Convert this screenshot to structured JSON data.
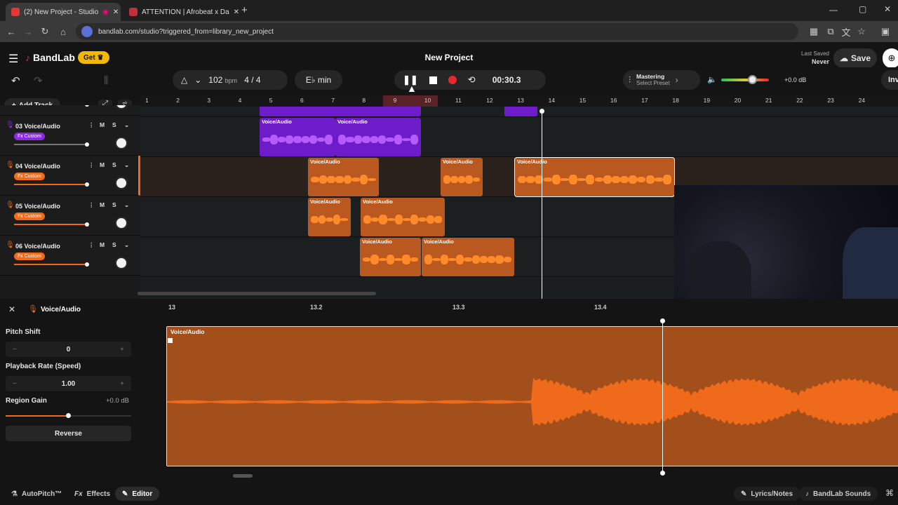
{
  "browser": {
    "tabs": [
      {
        "title": "(2) New Project - Studio",
        "active": true
      },
      {
        "title": "ATTENTION | Afrobeat x Da",
        "active": false
      }
    ],
    "url": "bandlab.com/studio?triggered_from=library_new_project"
  },
  "app": {
    "brand": "BandLab",
    "get_label": "Get",
    "project_title": "New Project",
    "last_saved_label": "Last Saved",
    "last_saved_value": "Never",
    "save_label": "Save"
  },
  "toolbar": {
    "bpm_value": "102",
    "bpm_unit": "bpm",
    "time_signature": "4 / 4",
    "key": "E♭ min",
    "time_display": "00:30.3",
    "mastering_title": "Mastering",
    "mastering_preset": "Select Preset",
    "master_volume": "+0.0 dB",
    "invite_label": "Inv"
  },
  "track_panel": {
    "add_track_label": "Add Track"
  },
  "ruler": {
    "bars": [
      "1",
      "2",
      "3",
      "4",
      "5",
      "6",
      "7",
      "8",
      "9",
      "10",
      "11",
      "12",
      "13",
      "14",
      "15",
      "16",
      "17",
      "18",
      "19",
      "20",
      "21",
      "22",
      "23",
      "24"
    ]
  },
  "tracks": [
    {
      "name": "",
      "fx": "Fx Custom",
      "color": "#8a2be2"
    },
    {
      "name": "03 Voice/Audio",
      "fx": "Fx Custom",
      "color": "#8a2be2"
    },
    {
      "name": "04 Voice/Audio",
      "fx": "Fx Custom",
      "color": "#ef6a1a"
    },
    {
      "name": "05 Voice/Audio",
      "fx": "Fx Custom",
      "color": "#ef6a1a"
    },
    {
      "name": "06 Voice/Audio",
      "fx": "Fx Custom",
      "color": "#ef6a1a"
    }
  ],
  "track_controls": {
    "mute": "M",
    "solo": "S",
    "more": "⋮"
  },
  "clip_label": "Voice/Audio",
  "editor": {
    "title": "Voice/Audio",
    "ruler_marks": [
      "13",
      "13.2",
      "13.3",
      "13.4"
    ],
    "pitch_shift_label": "Pitch Shift",
    "pitch_shift_value": "0",
    "playback_rate_label": "Playback Rate (Speed)",
    "playback_rate_value": "1.00",
    "region_gain_label": "Region Gain",
    "region_gain_value": "+0.0 dB",
    "reverse_label": "Reverse",
    "region_label": "Voice/Audio"
  },
  "bottom_tabs": {
    "autopitch": "AutoPitch™",
    "effects": "Effects",
    "editor": "Editor",
    "lyrics": "Lyrics/Notes",
    "sounds": "BandLab Sounds"
  },
  "colors": {
    "purple": "#8a2be2",
    "orange": "#ef6a1a",
    "record": "#e8262d",
    "accent_yellow": "#f5b800"
  }
}
